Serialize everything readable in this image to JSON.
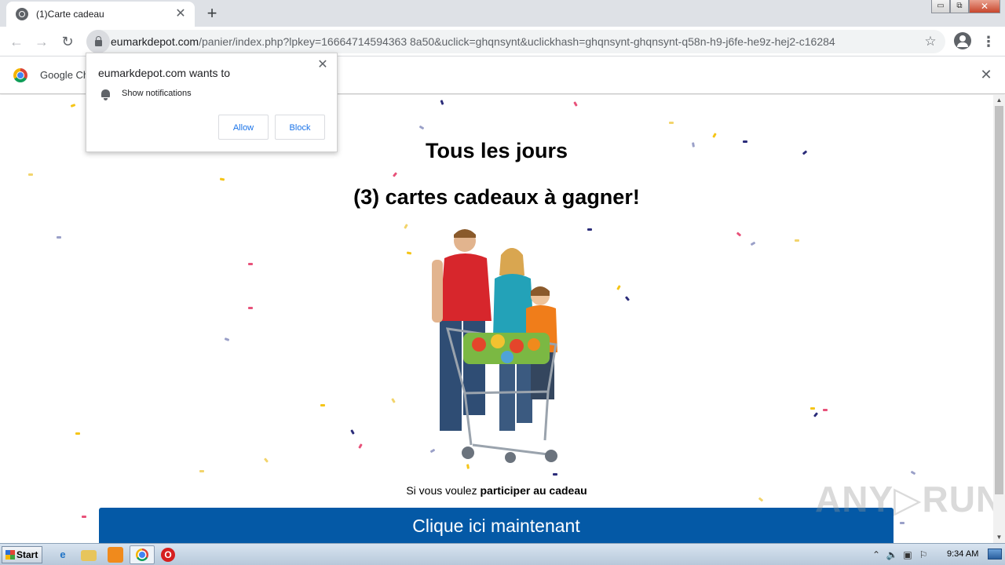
{
  "browser": {
    "tab_title": "(1)Carte cadeau",
    "tab_close_glyph": "✕",
    "new_tab_glyph": "+",
    "url_host": "eumarkdepot.com",
    "url_path": "/panier/index.php?lpkey=16664714594363 8a50&uclick=ghqnsynt&uclickhash=ghqnsynt-ghqnsynt-q58n-h9-j6fe-he9z-hej2-c16284",
    "back_glyph": "←",
    "forward_glyph": "→",
    "reload_glyph": "↻",
    "star_glyph": "☆",
    "menu_glyph": "⋮",
    "win_min": "▭",
    "win_max": "⧉",
    "win_close": "✕"
  },
  "infobar": {
    "text": "Google Ch",
    "close_glyph": "✕"
  },
  "notification": {
    "title": "eumarkdepot.com wants to",
    "permission": "Show notifications",
    "close_glyph": "✕",
    "allow_label": "Allow",
    "block_label": "Block"
  },
  "page": {
    "heading1": "Tous les jours",
    "heading2": "(3) cartes cadeaux à gagner!",
    "subtext_prefix": "Si vous voulez ",
    "subtext_bold": "participer au cadeau",
    "cta_label": "Clique ici maintenant",
    "watermark": "ANY▷RUN",
    "confetti_colors": [
      "#f5c518",
      "#2c2d7a",
      "#e8527a",
      "#9aa0c8",
      "#f2d46c"
    ]
  },
  "scrollbar": {
    "up_glyph": "▲",
    "down_glyph": "▼"
  },
  "taskbar": {
    "start_label": "Start",
    "ie_glyph": "e",
    "opera_glyph": "O",
    "tray_glyphs": [
      "⌃",
      "🔈",
      "▣",
      "⚐"
    ],
    "clock": "9:34 AM"
  }
}
